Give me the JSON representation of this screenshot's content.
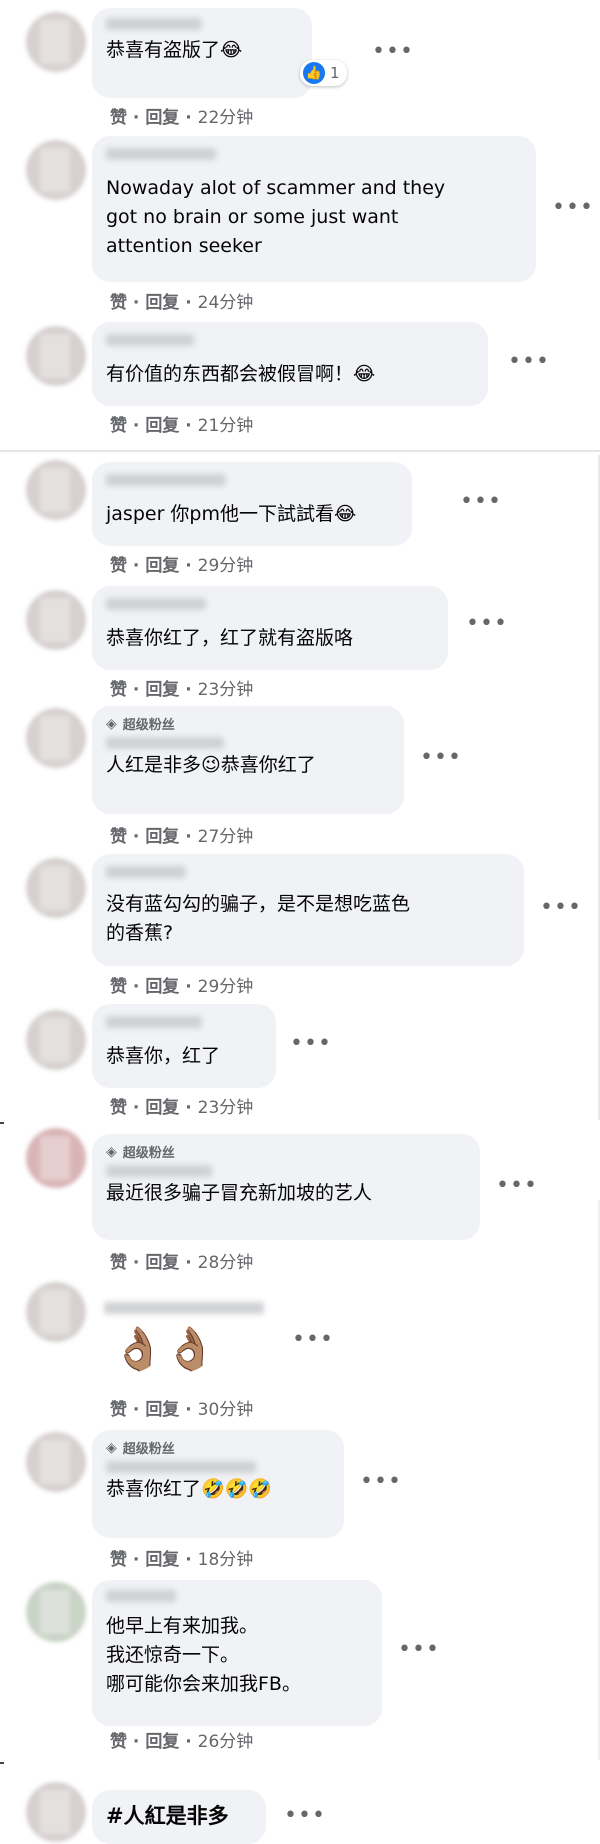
{
  "labels": {
    "like": "赞",
    "reply": "回复",
    "sep": "·",
    "more": "•••"
  },
  "reaction": {
    "count": "1",
    "icon": "like-thumb-icon"
  },
  "fan_badge": "超级粉丝",
  "comments": [
    {
      "text": "恭喜有盗版了😂",
      "time": "22分钟"
    },
    {
      "text": "Nowaday alot of scammer and they\ngot no brain or some just want\nattention seeker",
      "time": "24分钟"
    },
    {
      "text": "有价值的东西都会被假冒啊！😂",
      "time": "21分钟"
    },
    {
      "text": "jasper 你pm他一下試試看😂",
      "time": "29分钟"
    },
    {
      "text": "恭喜你红了，红了就有盗版咯",
      "time": "23分钟"
    },
    {
      "text": "人红是非多😉恭喜你红了",
      "time": "27分钟"
    },
    {
      "text": "没有蓝勾勾的骗子，是不是想吃蓝色\n的香蕉?",
      "time": "29分钟"
    },
    {
      "text": "恭喜你，红了",
      "time": "23分钟"
    },
    {
      "text": "最近很多骗子冒充新加坡的艺人",
      "time": "28分钟"
    },
    {
      "text": "👌🏽👌🏽",
      "time": "30分钟"
    },
    {
      "text": "恭喜你红了🤣🤣🤣",
      "time": "18分钟"
    },
    {
      "text": "他早上有来加我。\n我还惊奇一下。\n哪可能你会来加我FB。",
      "time": "26分钟"
    },
    {
      "text": "#人紅是非多"
    }
  ]
}
